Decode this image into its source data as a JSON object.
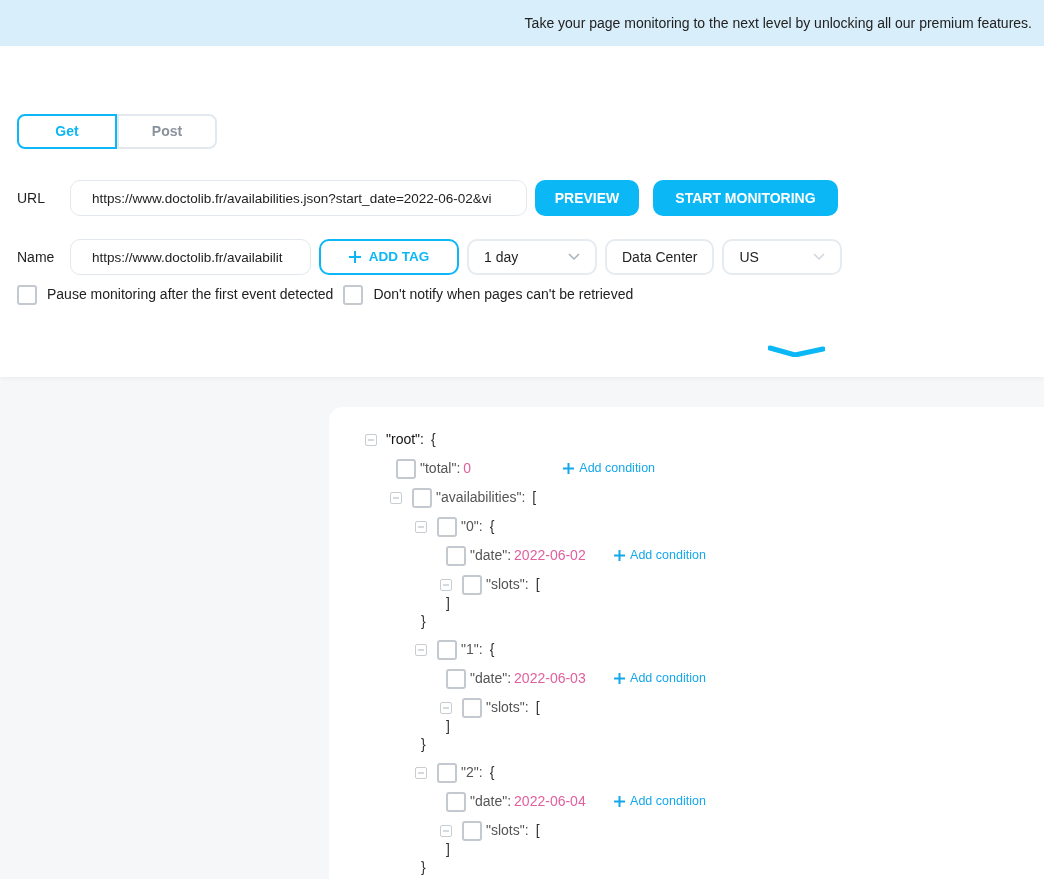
{
  "banner": {
    "text": "Take your page monitoring to the next level by unlocking all our premium features."
  },
  "method_tabs": [
    {
      "label": "Get",
      "selected": true
    },
    {
      "label": "Post",
      "selected": false
    }
  ],
  "url_row": {
    "label": "URL",
    "value": "https://www.doctolib.fr/availabilities.json?start_date=2022-06-02&vi",
    "buttons": [
      "PREVIEW",
      "START MONITORING"
    ]
  },
  "name_row": {
    "label": "Name",
    "value": "https://www.doctolib.fr/availabilit",
    "add_tag": "ADD TAG",
    "frequency": "1 day",
    "data_center_label": "Data Center",
    "region": "US"
  },
  "options": [
    {
      "label": "Pause monitoring after the first event detected",
      "checked": false
    },
    {
      "label": "Don't notify when pages can't be retrieved",
      "checked": false
    }
  ],
  "tree": {
    "key": "\"root\":",
    "open": "{",
    "expanded": true,
    "children": [
      {
        "key": "\"total\":",
        "value": "0",
        "checked": false,
        "add_condition": "Add condition"
      },
      {
        "key": "\"availabilities\":",
        "open": "[",
        "expanded": true,
        "checked": false,
        "children": [
          {
            "key": "\"0\":",
            "open": "{",
            "expanded": true,
            "checked": false,
            "close": "}",
            "children": [
              {
                "key": "\"date\":",
                "value": "2022-06-02",
                "checked": false,
                "add_condition": "Add condition"
              },
              {
                "key": "\"slots\":",
                "open": "[",
                "expanded": true,
                "checked": false,
                "close": "]"
              }
            ]
          },
          {
            "key": "\"1\":",
            "open": "{",
            "expanded": true,
            "checked": false,
            "close": "}",
            "children": [
              {
                "key": "\"date\":",
                "value": "2022-06-03",
                "checked": false,
                "add_condition": "Add condition"
              },
              {
                "key": "\"slots\":",
                "open": "[",
                "expanded": true,
                "checked": false,
                "close": "]"
              }
            ]
          },
          {
            "key": "\"2\":",
            "open": "{",
            "expanded": true,
            "checked": false,
            "close": "}",
            "children": [
              {
                "key": "\"date\":",
                "value": "2022-06-04",
                "checked": false,
                "add_condition": "Add condition"
              },
              {
                "key": "\"slots\":",
                "open": "[",
                "expanded": true,
                "checked": false,
                "close": "]"
              }
            ]
          }
        ]
      }
    ]
  }
}
